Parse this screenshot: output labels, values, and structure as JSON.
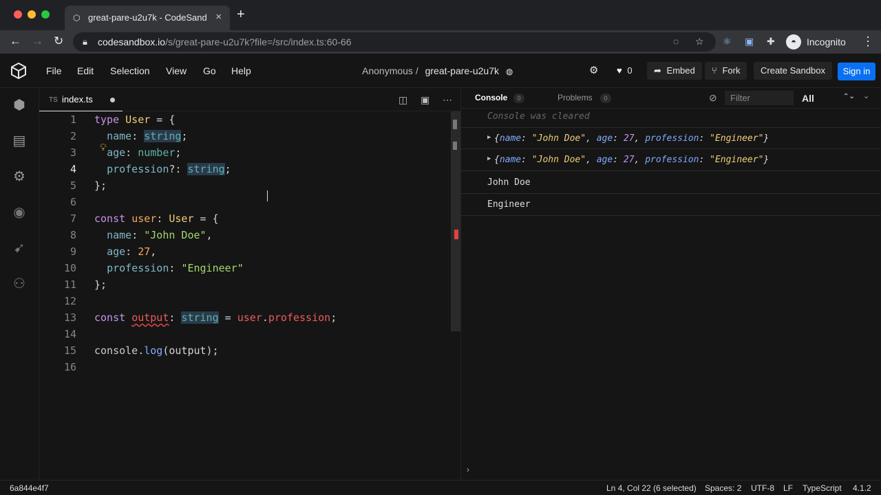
{
  "browser": {
    "tab_title": "great-pare-u2u7k - CodeSandbox",
    "url_host": "codesandbox.io",
    "url_path": "/s/great-pare-u2u7k?file=/src/index.ts:60-66",
    "profile_label": "Incognito"
  },
  "menu": [
    "File",
    "Edit",
    "Selection",
    "View",
    "Go",
    "Help"
  ],
  "header": {
    "owner": "Anonymous /",
    "sandbox_name": "great-pare-u2u7k",
    "likes": "0",
    "embed": "Embed",
    "fork": "Fork",
    "create": "Create Sandbox",
    "signin": "Sign in"
  },
  "editor": {
    "tab_lang": "TS",
    "tab_name": "index.ts",
    "line_numbers": [
      "1",
      "2",
      "3",
      "4",
      "5",
      "6",
      "7",
      "8",
      "9",
      "10",
      "11",
      "12",
      "13",
      "14",
      "15",
      "16"
    ],
    "active_line": 4
  },
  "console": {
    "tab_console": "Console",
    "console_count": "0",
    "tab_problems": "Problems",
    "problems_count": "0",
    "filter_placeholder": "Filter",
    "level": "All",
    "cleared": "Console was cleared",
    "plain_logs": [
      "John Doe",
      "Engineer"
    ]
  },
  "status": {
    "commit": "6a844e4f7",
    "position": "Ln 4, Col 22 (6 selected)",
    "spaces": "Spaces: 2",
    "encoding": "UTF-8",
    "eol": "LF",
    "language": "TypeScript",
    "version": "4.1.2"
  }
}
